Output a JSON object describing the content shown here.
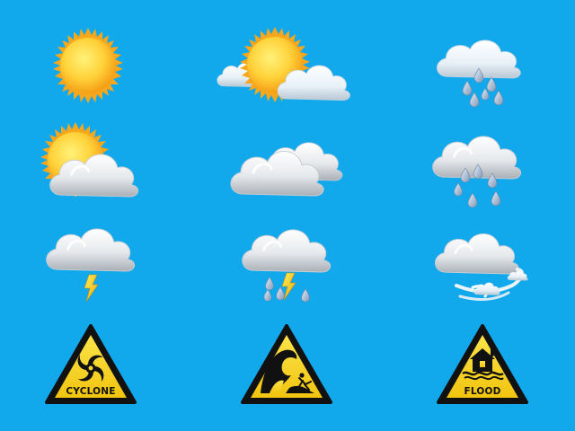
{
  "icons": {
    "cyclone_label": "CYCLONE",
    "flood_label": "FLOOD",
    "names": [
      "sunny-icon",
      "sun-behind-cloud-icon",
      "light-rain-icon",
      "partly-cloudy-icon",
      "overcast-icon",
      "heavy-rain-icon",
      "thunderstorm-icon",
      "thunderstorm-rain-icon",
      "windy-icon",
      "cyclone-warning-sign",
      "tsunami-warning-sign",
      "flood-warning-sign"
    ]
  },
  "colors": {
    "background": "#12A8EC",
    "sun": "#F7B21B",
    "cloud": "#E9ECEF",
    "rain": "#8FA9C9",
    "lightning": "#F5C518",
    "sign_yellow": "#F8D21C",
    "sign_black": "#111111"
  }
}
